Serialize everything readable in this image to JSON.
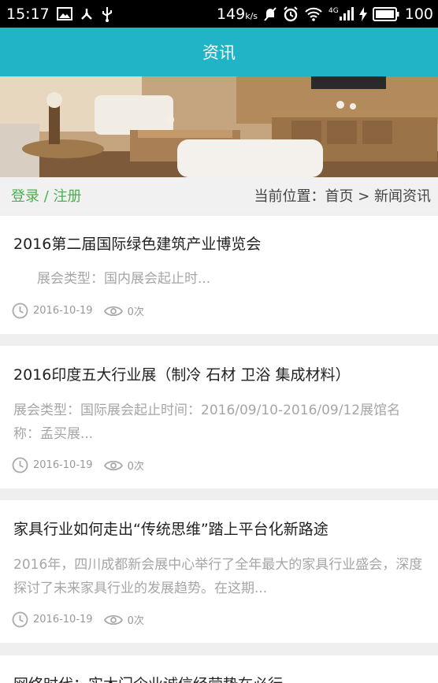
{
  "status_bar": {
    "time": "15:17",
    "speed_value": "149",
    "speed_unit": "k/s",
    "network_type": "4G",
    "battery": "100",
    "icons": [
      "image-icon",
      "usb-debug-icon",
      "usb-icon",
      "mute-icon",
      "alarm-icon",
      "wifi-icon",
      "signal-icon",
      "charging-icon",
      "battery-icon"
    ]
  },
  "header": {
    "title": "资讯"
  },
  "crumb": {
    "login_label": "登录 / 注册",
    "location": "当前位置：首页 > 新闻资讯"
  },
  "news": [
    {
      "title": "2016第二届国际绿色建筑产业博览会",
      "summary": "展会类型：国内展会起止时...",
      "date": "2016-10-19",
      "views": "0次"
    },
    {
      "title": "2016印度五大行业展（制冷 石材 卫浴 集成材料）",
      "summary": "展会类型：国际展会起止时间：2016/09/10-2016/09/12展馆名称：孟买展...",
      "date": "2016-10-19",
      "views": "0次"
    },
    {
      "title": "家具行业如何走出“传统思维”踏上平台化新路途",
      "summary": "2016年，四川成都新会展中心举行了全年最大的家具行业盛会，深度探讨了未来家具行业的发展趋势。在这期...",
      "date": "2016-10-19",
      "views": "0次"
    },
    {
      "title": "网络时代：实木门企业诚信经营势在必行"
    }
  ],
  "colors": {
    "header_bg": "#21b4c6",
    "login_green": "#4bb04e"
  }
}
